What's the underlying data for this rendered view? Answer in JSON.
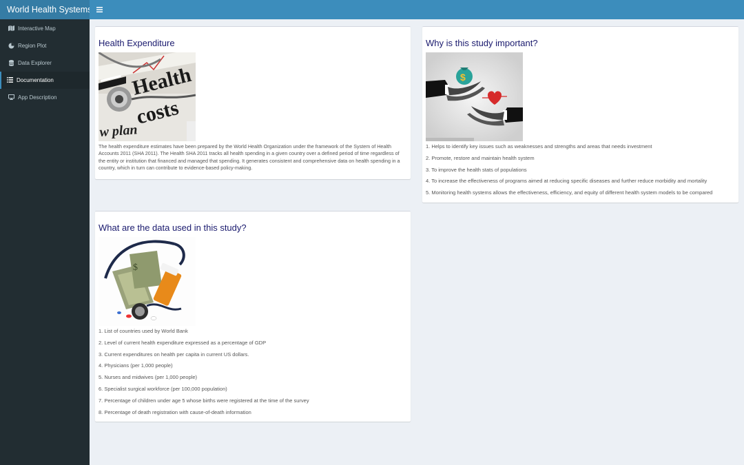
{
  "header": {
    "title": "World Health Systems"
  },
  "sidebar": {
    "items": [
      {
        "label": "Interactive Map",
        "icon": "map-icon"
      },
      {
        "label": "Region Plot",
        "icon": "pie-chart-icon"
      },
      {
        "label": "Data Explorer",
        "icon": "database-icon"
      },
      {
        "label": "Documentation",
        "icon": "list-icon",
        "active": true
      },
      {
        "label": "App Description",
        "icon": "desktop-icon"
      }
    ]
  },
  "boxes": {
    "expenditure": {
      "title": "Health Expenditure",
      "body": "The health expenditure estimates have been prepared by the World Health Organization under the framework of the System of Health Accounts 2011 (SHA 2011). The Health SHA 2011 tracks all health spending in a given country over a defined period of time regardless of the entity or institution that financed and managed that spending. It generates consistent and comprehensive data on health spending in a country, which in turn can contribute to evidence-based policy-making."
    },
    "importance": {
      "title": "Why is this study important?",
      "items": [
        "1. Helps to identify key issues such as weaknesses and strengths and areas that needs investment",
        "2. Promote, restore and maintain health system",
        "3. To improve the health stats of populations",
        "4. To increase the effectiveness of programs aimed at reducing specific diseases and further reduce morbidity and mortality",
        "5. Monitoring health systems allows the effectiveness, efficiency, and equity of different health system models to be compared"
      ]
    },
    "data": {
      "title": "What are the data used in this study?",
      "items": [
        "1. List of countries used by World Bank",
        "2. Level of current health expenditure expressed as a percentage of GDP",
        "3. Current expenditures on health per capita in current US dollars.",
        "4. Physicians (per 1,000 people)",
        "5. Nurses and midwives (per 1,000 people)",
        "6. Specialist surgical workforce (per 100,000 population)",
        "7. Percentage of children under age 5 whose births were registered at the time of the survey",
        "8. Percentage of death registration with cause-of-death information"
      ]
    }
  },
  "colors": {
    "header": "#3c8dbc",
    "logo_bg": "#357ca5",
    "sidebar": "#222d32",
    "content_bg": "#ecf0f5",
    "title_text": "#1a1a6e"
  }
}
